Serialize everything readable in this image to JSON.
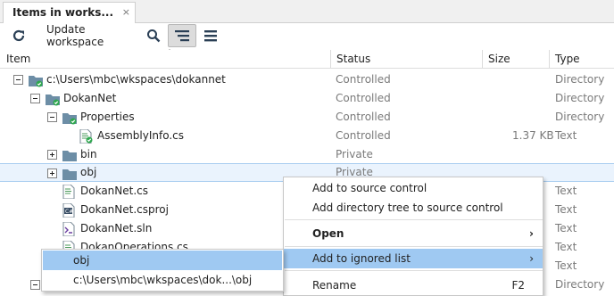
{
  "tab": {
    "title": "Items in works...",
    "close": "×"
  },
  "toolbar": {
    "update_label": "Update workspace"
  },
  "columns": {
    "item": "Item",
    "status": "Status",
    "size": "Size",
    "type": "Type"
  },
  "rows": [
    {
      "name": "c:\\Users\\mbc\\wkspaces\\dokannet",
      "status": "Controlled",
      "size": "",
      "type": "Directory"
    },
    {
      "name": "DokanNet",
      "status": "Controlled",
      "size": "",
      "type": "Directory"
    },
    {
      "name": "Properties",
      "status": "Controlled",
      "size": "",
      "type": "Directory"
    },
    {
      "name": "AssemblyInfo.cs",
      "status": "Controlled",
      "size": "1.37 KB",
      "type": "Text"
    },
    {
      "name": "bin",
      "status": "Private",
      "size": "",
      "type": ""
    },
    {
      "name": "obj",
      "status": "Private",
      "size": "",
      "type": ""
    },
    {
      "name": "DokanNet.cs",
      "status": "",
      "size": "",
      "type": "Text"
    },
    {
      "name": "DokanNet.csproj",
      "status": "",
      "size": "",
      "type": "Text"
    },
    {
      "name": "DokanNet.sln",
      "status": "",
      "size": "",
      "type": "Text"
    },
    {
      "name": "DokanOperations.cs",
      "status": "",
      "size": "",
      "type": "Text"
    },
    {
      "name": "",
      "status": "",
      "size": "",
      "type": "Text"
    },
    {
      "name": "",
      "status": "",
      "size": "",
      "type": "Directory"
    }
  ],
  "context_menu": {
    "items": [
      {
        "label": "Add to source control"
      },
      {
        "label": "Add directory tree to source control"
      },
      {
        "label": "Open",
        "arrow": "›"
      },
      {
        "label": "Add to ignored list",
        "arrow": "›"
      },
      {
        "label": "Rename",
        "shortcut": "F2"
      }
    ]
  },
  "submenu": {
    "items": [
      {
        "label": "obj"
      },
      {
        "label": "c:\\Users\\mbc\\wkspaces\\dok...\\obj"
      }
    ]
  },
  "colors": {
    "accent": "#9fc9f2",
    "folder": "#6d8ea6",
    "check": "#2fa84f",
    "selection": "#eaf3fd"
  }
}
